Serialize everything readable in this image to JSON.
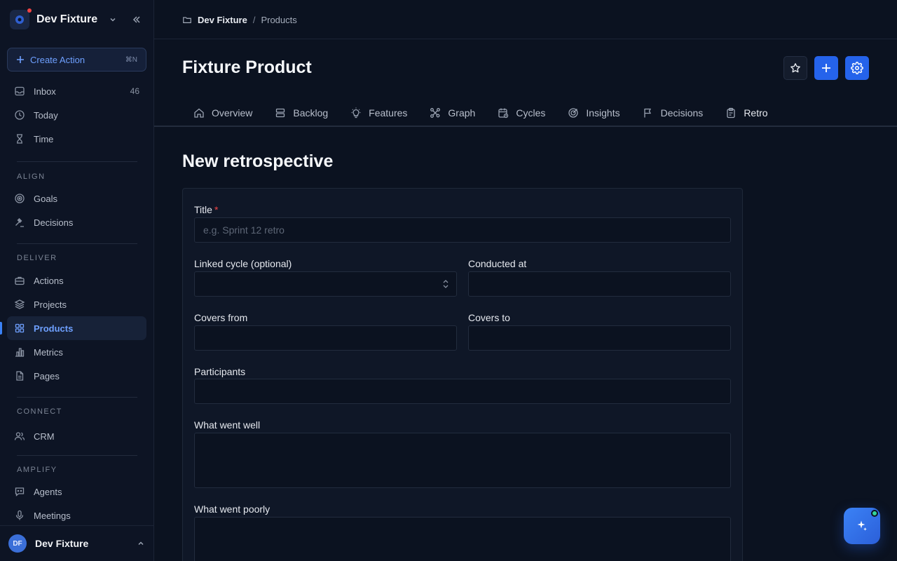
{
  "sidebar": {
    "workspace_name": "Dev Fixture",
    "create_action": {
      "label": "Create Action",
      "shortcut": "⌘N"
    },
    "top_items": [
      {
        "label": "Inbox",
        "count": "46",
        "icon": "inbox-icon"
      },
      {
        "label": "Today",
        "icon": "clock-icon"
      },
      {
        "label": "Time",
        "icon": "hourglass-icon"
      }
    ],
    "sections": [
      {
        "label": "ALIGN",
        "items": [
          {
            "label": "Goals",
            "icon": "target-icon"
          },
          {
            "label": "Decisions",
            "icon": "gavel-icon"
          }
        ]
      },
      {
        "label": "DELIVER",
        "items": [
          {
            "label": "Actions",
            "icon": "briefcase-icon"
          },
          {
            "label": "Projects",
            "icon": "layers-icon"
          },
          {
            "label": "Products",
            "icon": "grid-icon",
            "active": true
          },
          {
            "label": "Metrics",
            "icon": "bar-chart-icon"
          },
          {
            "label": "Pages",
            "icon": "file-icon"
          }
        ]
      },
      {
        "label": "CONNECT",
        "items": [
          {
            "label": "CRM",
            "icon": "users-icon"
          }
        ]
      },
      {
        "label": "AMPLIFY",
        "items": [
          {
            "label": "Agents",
            "icon": "chat-bot-icon"
          },
          {
            "label": "Meetings",
            "icon": "microphone-icon"
          }
        ]
      }
    ],
    "user": {
      "initials": "DF",
      "name": "Dev Fixture"
    }
  },
  "breadcrumb": {
    "workspace": "Dev Fixture",
    "separator": "/",
    "current": "Products"
  },
  "page": {
    "title": "Fixture Product"
  },
  "tabs": [
    {
      "label": "Overview",
      "icon": "home-icon"
    },
    {
      "label": "Backlog",
      "icon": "stack-icon"
    },
    {
      "label": "Features",
      "icon": "lightbulb-icon"
    },
    {
      "label": "Graph",
      "icon": "graph-icon"
    },
    {
      "label": "Cycles",
      "icon": "calendar-icon"
    },
    {
      "label": "Insights",
      "icon": "target-icon"
    },
    {
      "label": "Decisions",
      "icon": "flag-icon"
    },
    {
      "label": "Retro",
      "icon": "clipboard-icon",
      "active": true
    }
  ],
  "form": {
    "heading": "New retrospective",
    "title_label": "Title",
    "title_required": "*",
    "title_placeholder": "e.g. Sprint 12 retro",
    "linked_cycle_label": "Linked cycle (optional)",
    "conducted_at_label": "Conducted at",
    "covers_from_label": "Covers from",
    "covers_to_label": "Covers to",
    "participants_label": "Participants",
    "went_well_label": "What went well",
    "went_poorly_label": "What went poorly"
  },
  "colors": {
    "accent": "#3b82f6",
    "primary_button": "#2563eb",
    "background": "#0b1220",
    "online": "#34d399"
  }
}
